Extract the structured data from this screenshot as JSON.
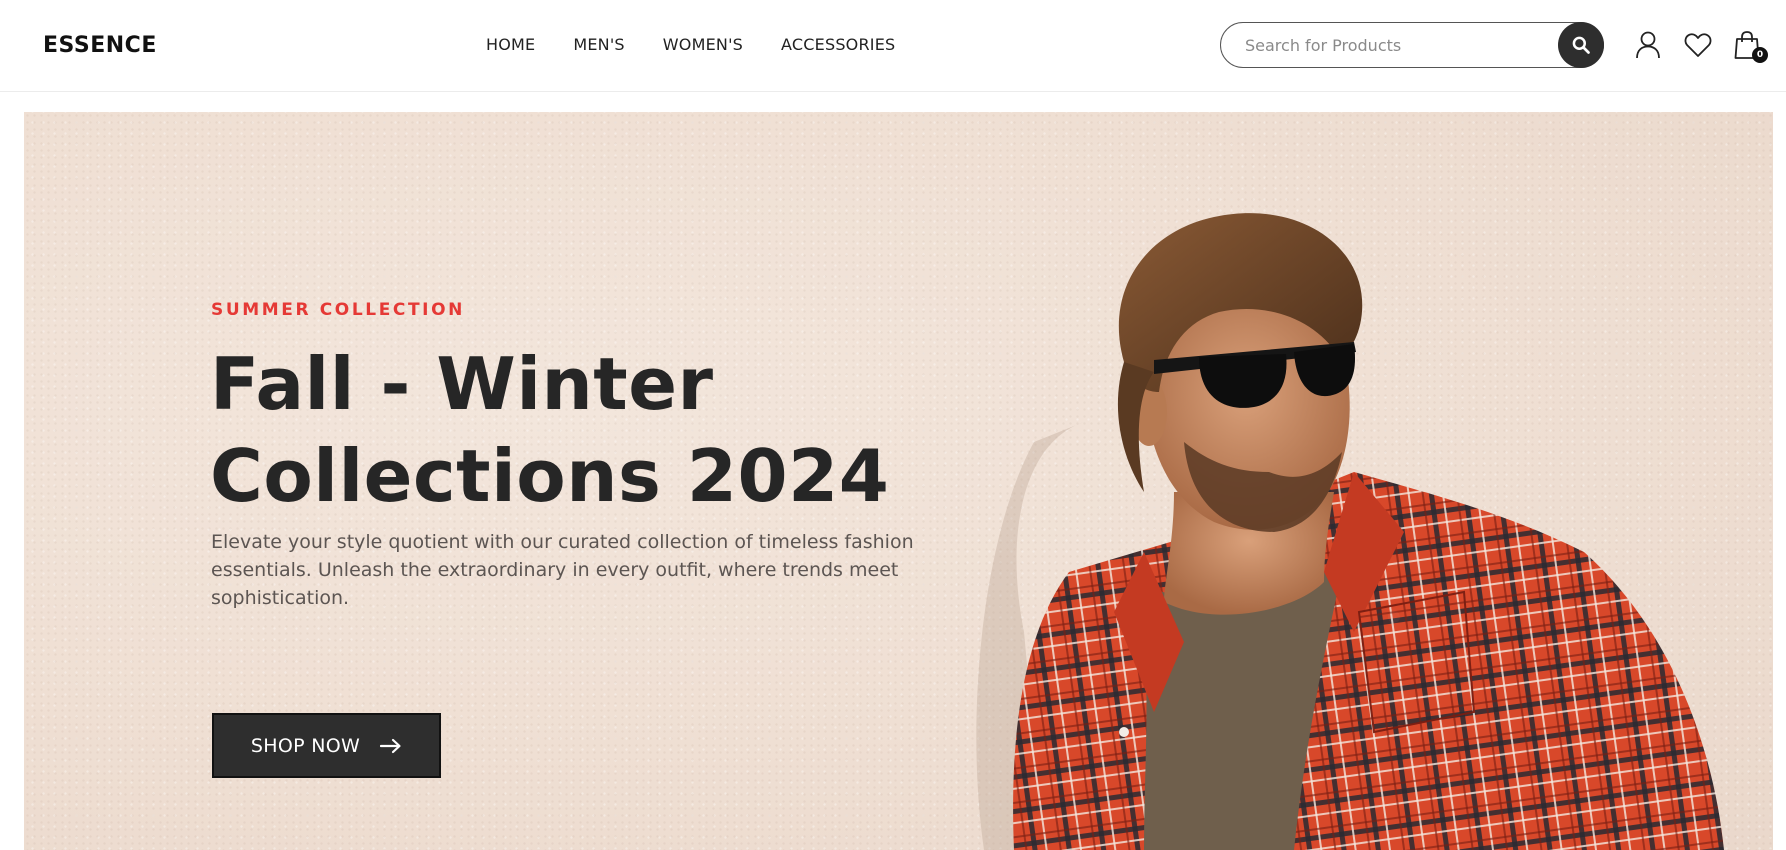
{
  "brand": {
    "logo_text": "ESSENCE"
  },
  "nav": {
    "items": [
      {
        "label": "HOME"
      },
      {
        "label": "MEN'S"
      },
      {
        "label": "WOMEN'S"
      },
      {
        "label": "ACCESSORIES"
      }
    ]
  },
  "search": {
    "placeholder": "Search for Products",
    "value": "",
    "button_icon": "search-icon"
  },
  "header_icons": {
    "account_icon": "user-icon",
    "wishlist_icon": "heart-icon",
    "cart_icon": "shopping-bag-icon",
    "cart_count": "0"
  },
  "hero": {
    "eyebrow": "SUMMER COLLECTION",
    "headline_line1": "Fall - Winter",
    "headline_line2": "Collections 2024",
    "description": "Elevate your style quotient with our curated collection of timeless fashion essentials. Unleash the extraordinary in every outfit, where trends meet sophistication.",
    "cta_label": "SHOP NOW",
    "cta_icon": "arrow-right-icon",
    "image_subject": "model-photo"
  },
  "colors": {
    "accent": "#e53935",
    "dark": "#2e2e2e",
    "hero_bg": "#efdfd3",
    "text": "#262626"
  }
}
